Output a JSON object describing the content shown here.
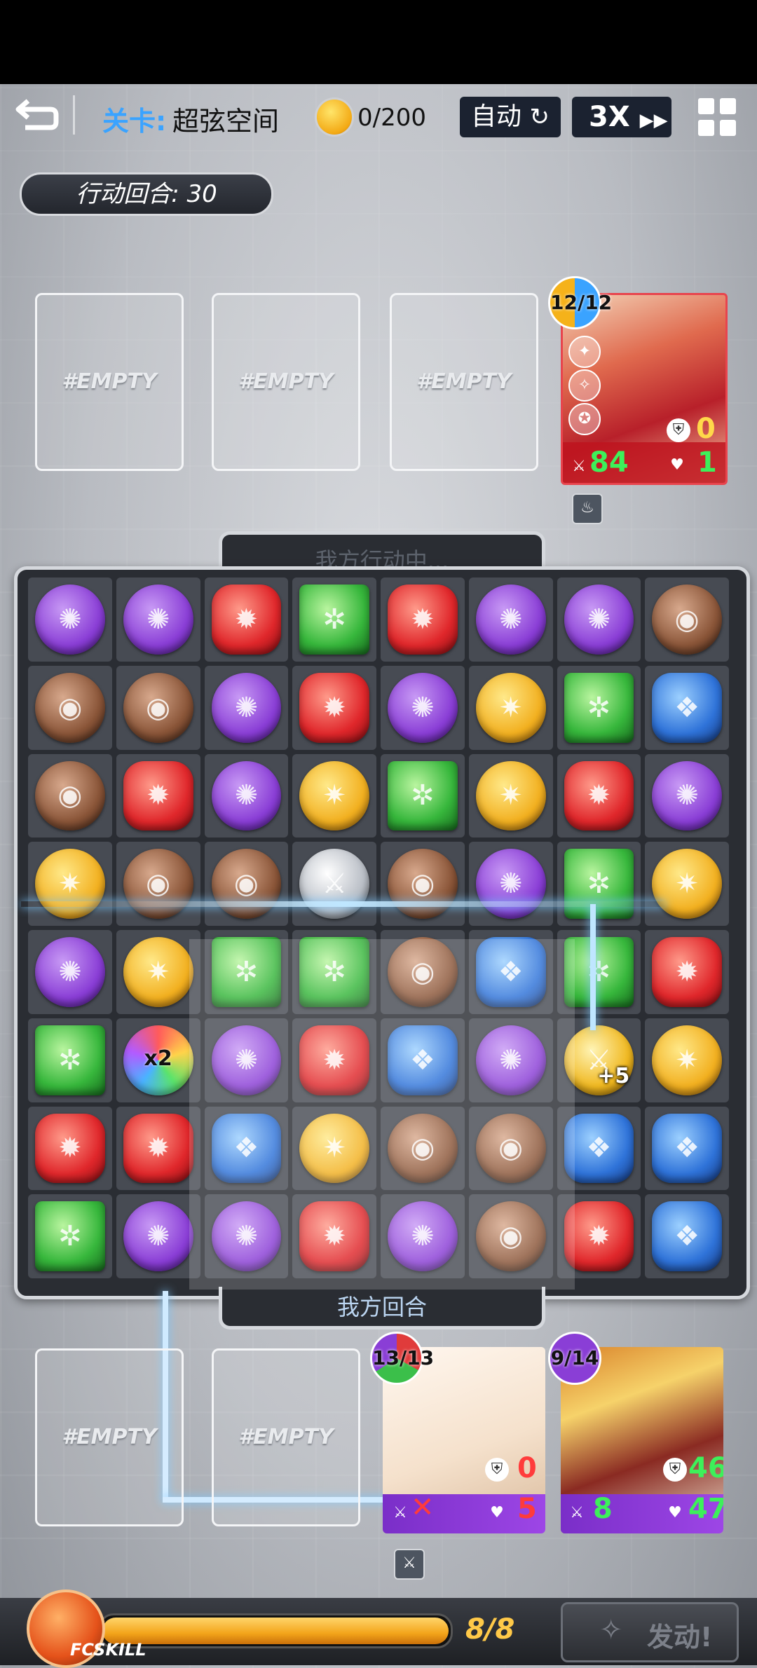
{
  "topbar": {
    "stage_label": "关卡:",
    "stage_name": "超弦空间",
    "coins": "0/200",
    "auto_label": "自动",
    "auto_icon": "refresh-icon",
    "speed_label": "3X",
    "speed_icon": "fast-forward-icon",
    "menu_icon": "grid-menu-icon",
    "back_icon": "back-arrow-icon"
  },
  "turn_counter": "行动回合: 30",
  "enemy_slots": [
    "#EMPTY",
    "#EMPTY",
    "#EMPTY"
  ],
  "enemy_card": {
    "badge": "12/12",
    "attack": "84",
    "shield": "0",
    "hp": "1",
    "buff_icon": "flame-aura-icon"
  },
  "board": {
    "top_status": "我方行动中...",
    "bottom_status": "我方回合",
    "rows": [
      [
        "purple",
        "purple",
        "red",
        "green",
        "red",
        "purple",
        "purple",
        "brown"
      ],
      [
        "brown",
        "brown",
        "purple",
        "red",
        "purple",
        "yellow",
        "green",
        "blue"
      ],
      [
        "brown",
        "red",
        "purple",
        "yellow",
        "green",
        "yellow",
        "red",
        "purple"
      ],
      [
        "yellow",
        "brown",
        "brown",
        "sword",
        "brown",
        "purple",
        "green",
        "yellow"
      ],
      [
        "purple",
        "yellow",
        "green",
        "green",
        "brown",
        "blue",
        "green",
        "red"
      ],
      [
        "green",
        "rainbow",
        "purple",
        "red",
        "blue",
        "purple",
        "sword-gold",
        "yellow"
      ],
      [
        "red",
        "red",
        "blue",
        "yellow",
        "brown",
        "brown",
        "blue",
        "blue"
      ],
      [
        "green",
        "purple",
        "purple",
        "red",
        "purple",
        "brown",
        "red",
        "blue"
      ]
    ],
    "specials": {
      "rainbow_label": "x2",
      "sword_gold_label": "+5"
    }
  },
  "hero_slots": [
    "#EMPTY",
    "#EMPTY"
  ],
  "hero_cards": [
    {
      "badge": "13/13",
      "attack": "",
      "shield": "0",
      "hp": "5",
      "attack_disabled": true,
      "buff_icon": "sword-buff-icon"
    },
    {
      "badge": "9/14",
      "attack": "8",
      "shield": "46",
      "hp": "47"
    }
  ],
  "skill_bar": {
    "emblem_label": "FCSKILL",
    "energy": "8/8",
    "energy_fraction": 1.0,
    "launch_label": "发动!"
  },
  "colors": {
    "accent_blue": "#3aa3ff",
    "energy_text": "#ffc948",
    "attack_green": "#3df05a",
    "hp_red": "#ff3b3b"
  }
}
